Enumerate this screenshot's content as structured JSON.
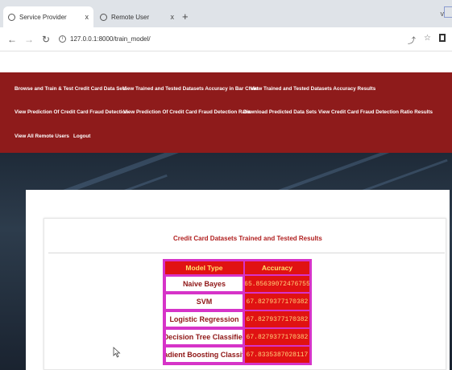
{
  "browser": {
    "tabs": [
      {
        "title": "Service Provider",
        "active": true
      },
      {
        "title": "Remote User",
        "active": false
      }
    ],
    "url": "127.0.0.1:8000/train_model/",
    "tab_close": "x",
    "new_tab": "+",
    "window_control": "v"
  },
  "nav": {
    "links": [
      "Browse and Train & Test Credit Card Data Sets",
      "View Trained and Tested Datasets Accuracy in Bar Chart",
      "View Trained and Tested Datasets Accuracy Results",
      "View Prediction Of Credit Card Fraud Detection",
      "View Prediction Of Credit Card Fraud Detection Ratio",
      "Download Predicted Data Sets",
      "View Credit Card Fraud Detection Ratio Results",
      "View All Remote Users",
      "Logout"
    ]
  },
  "results": {
    "title": "Credit Card Datasets Trained and Tested Results",
    "headers": [
      "Model Type",
      "Accuracy"
    ],
    "rows": [
      {
        "model": "Naive Bayes",
        "accuracy": "65.85639072476755"
      },
      {
        "model": "SVM",
        "accuracy": "67.8279377170382"
      },
      {
        "model": "Logistic Regression",
        "accuracy": "67.8279377170382"
      },
      {
        "model": "Decision Tree Classifier",
        "accuracy": "67.8279377170382"
      },
      {
        "model": "Gradient Boosting Classifier",
        "accuracy": "67.8335387028117"
      }
    ]
  },
  "colors": {
    "nav_bg": "#8e1b1b",
    "table_border": "#d633c8",
    "accuracy_bg": "#e01212",
    "title_red": "#b01e1e"
  }
}
